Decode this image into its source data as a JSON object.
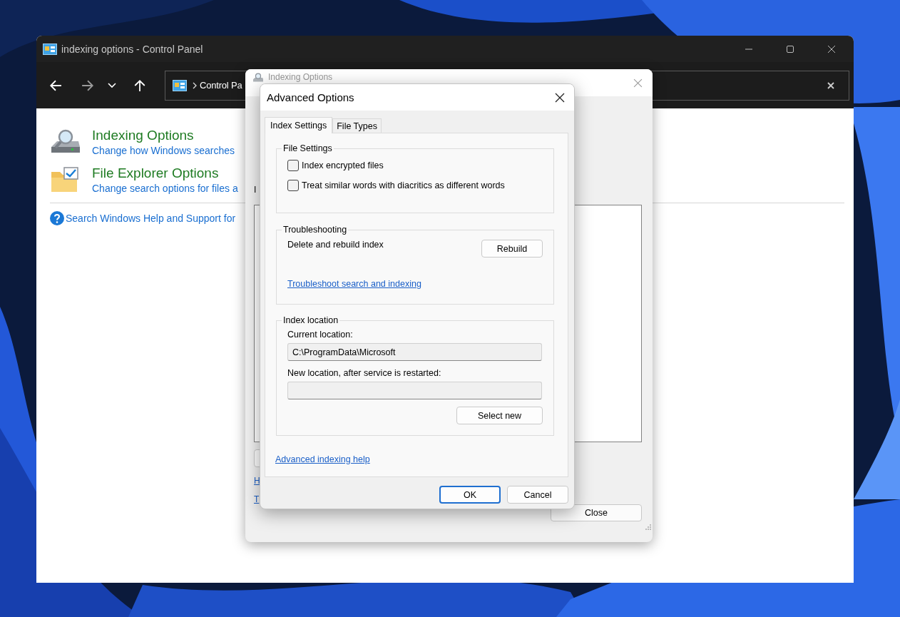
{
  "control_panel": {
    "title": "indexing options - Control Panel",
    "address": "Control Pa",
    "items": [
      {
        "kind": "indexing",
        "title": "Indexing Options",
        "subtitle": "Change how Windows searches"
      },
      {
        "kind": "folder",
        "title": "File Explorer Options",
        "subtitle": "Change search options for files a"
      }
    ],
    "help_link": "Search Windows Help and Support for"
  },
  "indexing_dialog": {
    "title": "Indexing Options",
    "label": "I",
    "links": [
      "H",
      "T"
    ],
    "close_button": "Close"
  },
  "advanced_dialog": {
    "title": "Advanced Options",
    "tabs": [
      {
        "label": "Index Settings",
        "selected": true
      },
      {
        "label": "File Types",
        "selected": false
      }
    ],
    "file_settings": {
      "legend": "File Settings",
      "checkboxes": [
        {
          "label": "Index encrypted files",
          "checked": false
        },
        {
          "label": "Treat similar words with diacritics as different words",
          "checked": false
        }
      ]
    },
    "troubleshooting": {
      "legend": "Troubleshooting",
      "text": "Delete and rebuild index",
      "button": "Rebuild",
      "link": "Troubleshoot search and indexing"
    },
    "index_location": {
      "legend": "Index location",
      "current_label": "Current location:",
      "current_value": "C:\\ProgramData\\Microsoft",
      "new_label": "New location, after service is restarted:",
      "button": "Select new"
    },
    "help_link": "Advanced indexing help",
    "buttons": [
      {
        "label": "OK",
        "default": true
      },
      {
        "label": "Cancel",
        "default": false
      }
    ]
  }
}
